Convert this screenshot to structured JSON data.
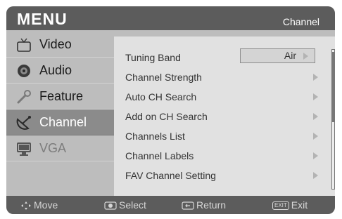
{
  "header": {
    "title": "MENU",
    "breadcrumb": "Channel"
  },
  "sidebar": {
    "items": [
      {
        "label": "Video",
        "icon": "tv-set-icon",
        "state": "normal"
      },
      {
        "label": "Audio",
        "icon": "speaker-icon",
        "state": "normal"
      },
      {
        "label": "Feature",
        "icon": "wrench-icon",
        "state": "normal"
      },
      {
        "label": "Channel",
        "icon": "satellite-dish-icon",
        "state": "selected"
      },
      {
        "label": "VGA",
        "icon": "monitor-icon",
        "state": "disabled"
      }
    ]
  },
  "panel": {
    "items": [
      {
        "label": "Tuning Band",
        "value": "Air"
      },
      {
        "label": "Channel Strength"
      },
      {
        "label": "Auto CH Search"
      },
      {
        "label": "Add on CH Search"
      },
      {
        "label": "Channels List"
      },
      {
        "label": "Channel Labels"
      },
      {
        "label": "FAV Channel Setting"
      }
    ]
  },
  "footer": {
    "move": "Move",
    "select": "Select",
    "return": "Return",
    "exit_key": "EXIT",
    "exit": "Exit"
  },
  "colors": {
    "header": "#5c5c5c",
    "body": "#bdbdbd",
    "panel": "#e1e1e1",
    "selected": "#8b8b8b"
  }
}
